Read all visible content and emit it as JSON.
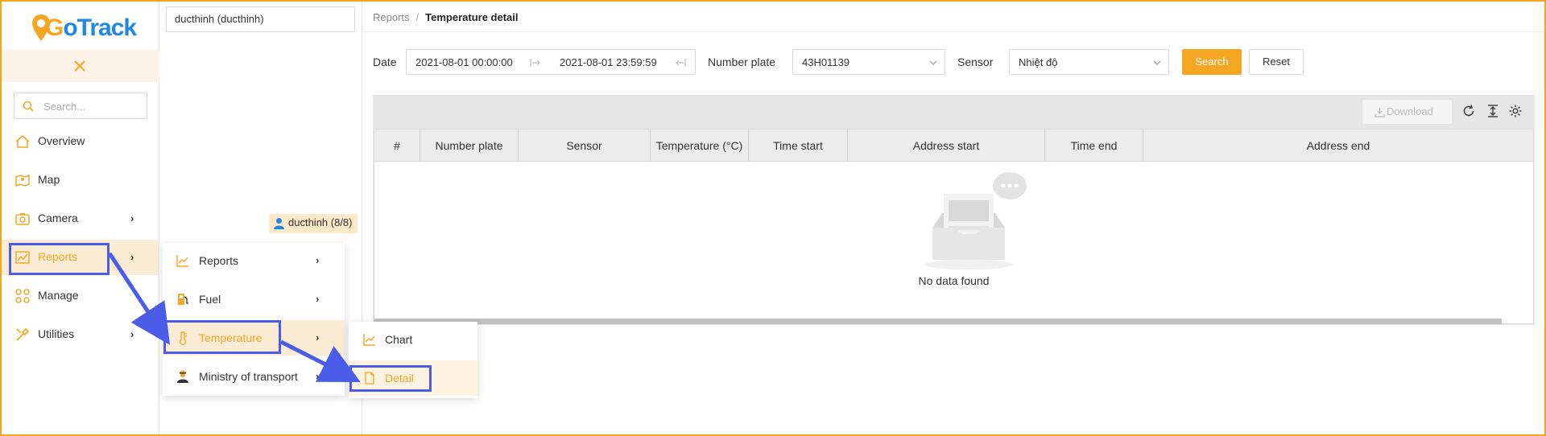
{
  "app": {
    "logo_text_g": "G",
    "logo_text_rest": "oTrack",
    "brand_color": "#f5a623",
    "accent_blue": "#1e88e5"
  },
  "sidebar": {
    "search_placeholder": "Search...",
    "items": [
      {
        "label": "Overview",
        "icon": "home-icon",
        "has_submenu": false
      },
      {
        "label": "Map",
        "icon": "map-icon",
        "has_submenu": false
      },
      {
        "label": "Camera",
        "icon": "camera-icon",
        "has_submenu": true
      },
      {
        "label": "Reports",
        "icon": "chart-line-icon",
        "has_submenu": true,
        "active": true
      },
      {
        "label": "Manage",
        "icon": "grid-icon",
        "has_submenu": false
      },
      {
        "label": "Utilities",
        "icon": "tools-icon",
        "has_submenu": true
      }
    ],
    "chevron": "›"
  },
  "user_panel": {
    "selected_user": "ducthinh (ducthinh)",
    "badge": "ducthinh (8/8)"
  },
  "breadcrumb": {
    "parent": "Reports",
    "separator": "/",
    "current": "Temperature detail"
  },
  "filters": {
    "date_label": "Date",
    "date_start": "2021-08-01 00:00:00",
    "date_end": "2021-08-01 23:59:59",
    "plate_label": "Number plate",
    "plate_value": "43H01139",
    "sensor_label": "Sensor",
    "sensor_value": "Nhiệt độ",
    "search_button": "Search",
    "reset_button": "Reset"
  },
  "table": {
    "download_label": "Download",
    "columns": [
      "#",
      "Number plate",
      "Sensor",
      "Temperature (°C)",
      "Time start",
      "Address start",
      "Time end",
      "Address end"
    ],
    "empty_text": "No data found"
  },
  "reports_menu": {
    "items": [
      {
        "label": "Reports",
        "icon": "chart-line-icon"
      },
      {
        "label": "Fuel",
        "icon": "fuel-icon"
      },
      {
        "label": "Temperature",
        "icon": "thermometer-icon",
        "active": true
      },
      {
        "label": "Ministry of transport",
        "icon": "officer-icon"
      }
    ]
  },
  "temperature_menu": {
    "items": [
      {
        "label": "Chart",
        "icon": "chart-line-icon"
      },
      {
        "label": "Detail",
        "icon": "document-icon",
        "active": true
      }
    ]
  },
  "annotation_color": "#4a5ce8"
}
